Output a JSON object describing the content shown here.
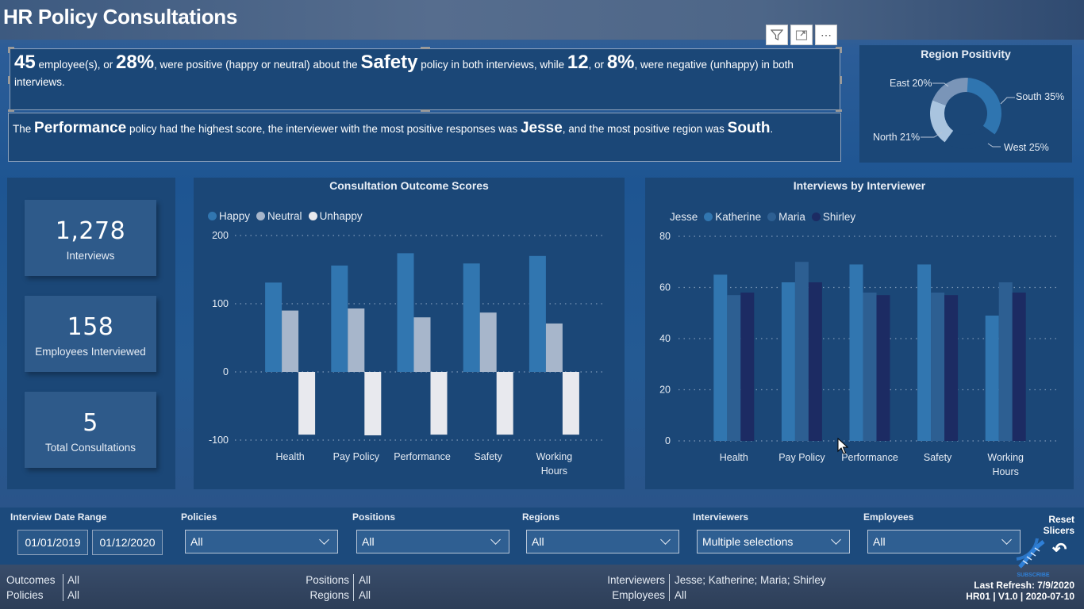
{
  "title": "HR Policy Consultations",
  "visual_header": {
    "icons": [
      "filter-icon",
      "focus-mode-icon",
      "more-options-icon"
    ],
    "more_label": "⋯"
  },
  "narrative1": {
    "count_positive": "45",
    "t1": " employee(s), or ",
    "pct_positive": "28%",
    "t2": ", were positive (happy or neutral) about the ",
    "policy": "Safety",
    "t3": " policy in both interviews, while ",
    "count_negative": "12",
    "t4": ", or ",
    "pct_negative": "8%",
    "t5": ", were negative (unhappy) in both interviews."
  },
  "narrative2": {
    "t1": "The ",
    "top_policy": "Performance",
    "t2": " policy had the highest score, the interviewer with the most positive responses was ",
    "top_interviewer": "Jesse",
    "t3": ", and the most positive region was ",
    "top_region": "South",
    "t4": "."
  },
  "region_positivity": {
    "title": "Region Positivity",
    "slices": [
      {
        "name": "South",
        "pct": 35,
        "label": "South 35%",
        "color": "#2f75b0"
      },
      {
        "name": "West",
        "pct": 25,
        "label": "West 25%",
        "color": "#1b4777"
      },
      {
        "name": "North",
        "pct": 21,
        "label": "North 21%",
        "color": "#a9c4df"
      },
      {
        "name": "East",
        "pct": 20,
        "label": "East 20%",
        "color": "#7a95b8"
      }
    ]
  },
  "kpis": [
    {
      "value": "1,278",
      "label": "Interviews"
    },
    {
      "value": "158",
      "label": "Employees Interviewed"
    },
    {
      "value": "5",
      "label": "Total Consultations"
    }
  ],
  "chart_data": [
    {
      "type": "bar",
      "title": "Consultation Outcome Scores",
      "categories": [
        "Health",
        "Pay Policy",
        "Performance",
        "Safety",
        "Working Hours"
      ],
      "series": [
        {
          "name": "Happy",
          "color": "#3176b0",
          "values": [
            131,
            156,
            174,
            159,
            170
          ]
        },
        {
          "name": "Neutral",
          "color": "#a7b6cb",
          "values": [
            90,
            93,
            80,
            87,
            71
          ]
        },
        {
          "name": "Unhappy",
          "color": "#e8e9ee",
          "values": [
            -92,
            -93,
            -92,
            -92,
            -92
          ]
        }
      ],
      "yticks": [
        200,
        100,
        0,
        -100
      ],
      "ylim": [
        -100,
        200
      ],
      "legend": "top-left",
      "grid": true,
      "xlabel": "",
      "ylabel": ""
    },
    {
      "type": "bar",
      "title": "Interviews by Interviewer",
      "categories": [
        "Health",
        "Pay Policy",
        "Performance",
        "Safety",
        "Working Hours"
      ],
      "series": [
        {
          "name": "Jesse",
          "color": "#1b4777",
          "values": [
            null,
            null,
            null,
            null,
            null
          ]
        },
        {
          "name": "Katherine",
          "color": "#3176b0",
          "values": [
            65,
            62,
            69,
            69,
            49
          ]
        },
        {
          "name": "Maria",
          "color": "#2d5f92",
          "values": [
            57,
            70,
            58,
            58,
            62
          ]
        },
        {
          "name": "Shirley",
          "color": "#1c2b63",
          "values": [
            58,
            62,
            57,
            57,
            58
          ]
        }
      ],
      "yticks": [
        80,
        60,
        40,
        20,
        0
      ],
      "ylim": [
        0,
        80
      ],
      "legend": "top-left",
      "grid": true,
      "xlabel": "",
      "ylabel": ""
    }
  ],
  "slicers": {
    "date_range": {
      "label": "Interview Date Range",
      "start": "01/01/2019",
      "end": "01/12/2020"
    },
    "policies": {
      "label": "Policies",
      "value": "All"
    },
    "positions": {
      "label": "Positions",
      "value": "All"
    },
    "regions": {
      "label": "Regions",
      "value": "All"
    },
    "interviewers": {
      "label": "Interviewers",
      "value": "Multiple selections"
    },
    "employees": {
      "label": "Employees",
      "value": "All"
    },
    "reset_label_1": "Reset",
    "reset_label_2": "Slicers",
    "reset_icon": "↶"
  },
  "filter_summary": {
    "outcomes": {
      "label": "Outcomes",
      "value": "All"
    },
    "policies": {
      "label": "Policies",
      "value": "All"
    },
    "positions": {
      "label": "Positions",
      "value": "All"
    },
    "regions": {
      "label": "Regions",
      "value": "All"
    },
    "interviewers": {
      "label": "Interviewers",
      "value": "Jesse; Katherine; Maria; Shirley"
    },
    "employees": {
      "label": "Employees",
      "value": "All"
    }
  },
  "footer": {
    "last_refresh": "Last Refresh: 7/9/2020",
    "version": "HR01 | V1.0 | 2020-07-10",
    "subscribe": "SUBSCRIBE"
  }
}
